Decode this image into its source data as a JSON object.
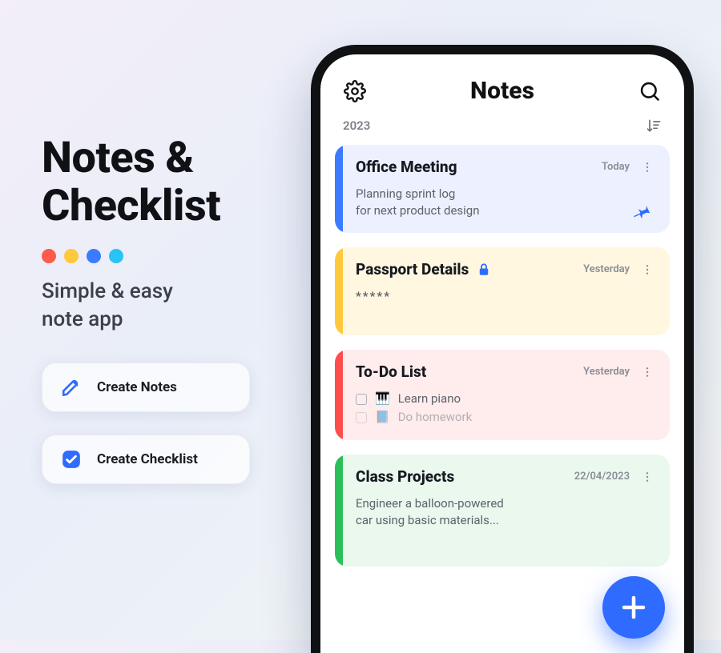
{
  "promo": {
    "headline_l1": "Notes &",
    "headline_l2": "Checklist",
    "tagline_l1": "Simple & easy",
    "tagline_l2": "note app",
    "chip_notes": "Create Notes",
    "chip_checklist": "Create Checklist",
    "dot_colors": [
      "#ff5a4c",
      "#ffc93c",
      "#3b7bff",
      "#27c4f5"
    ]
  },
  "app": {
    "title": "Notes",
    "year": "2023"
  },
  "notes": [
    {
      "color": "blue",
      "title": "Office Meeting",
      "date": "Today",
      "body_l1": "Planning sprint log",
      "body_l2": "for next product design",
      "pinned": true,
      "locked": false
    },
    {
      "color": "yellow",
      "title": "Passport Details",
      "date": "Yesterday",
      "body_l1": "*****",
      "body_l2": "",
      "pinned": false,
      "locked": true
    },
    {
      "color": "red",
      "title": "To-Do List",
      "date": "Yesterday",
      "checklist": [
        {
          "emoji": "🎹",
          "text": "Learn piano"
        },
        {
          "emoji": "📘",
          "text": "Do homework"
        }
      ],
      "pinned": false,
      "locked": false
    },
    {
      "color": "green",
      "title": "Class Projects",
      "date": "22/04/2023",
      "body_l1": "Engineer a balloon-powered",
      "body_l2": "car using basic materials...",
      "pinned": false,
      "locked": false
    }
  ],
  "colors": {
    "accent": "#2f6bff"
  }
}
